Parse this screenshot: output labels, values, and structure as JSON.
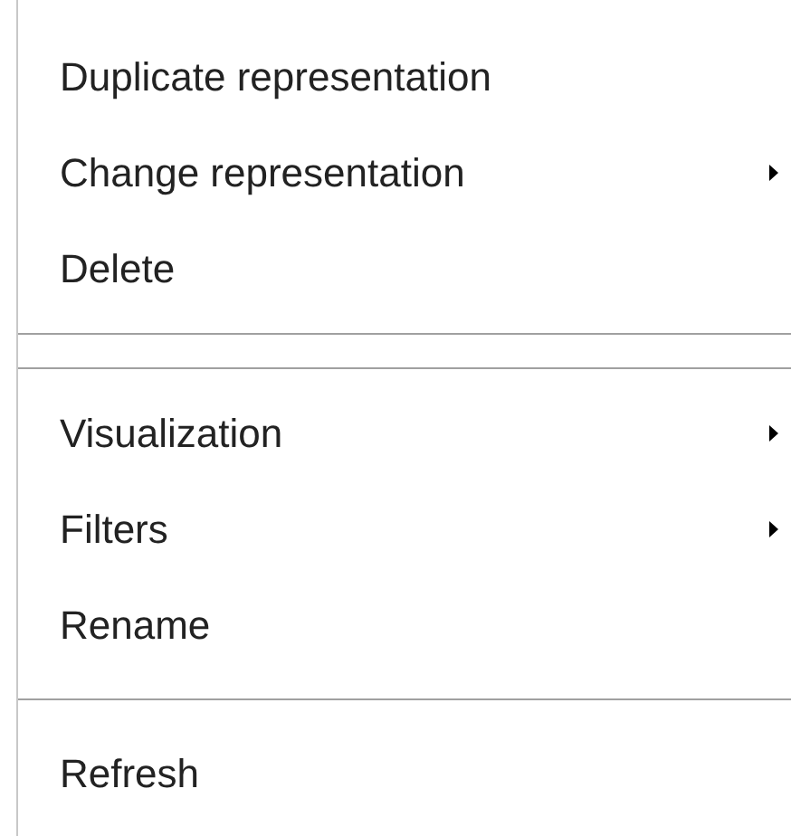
{
  "menu": {
    "items": [
      {
        "kind": "item",
        "label": "Duplicate representation",
        "has_submenu": false
      },
      {
        "kind": "item",
        "label": "Change representation",
        "has_submenu": true
      },
      {
        "kind": "item",
        "label": "Delete",
        "has_submenu": false
      },
      {
        "kind": "separator"
      },
      {
        "kind": "separator"
      },
      {
        "kind": "item",
        "label": "Visualization",
        "has_submenu": true
      },
      {
        "kind": "item",
        "label": "Filters",
        "has_submenu": true
      },
      {
        "kind": "item",
        "label": "Rename",
        "has_submenu": false
      },
      {
        "kind": "separator"
      },
      {
        "kind": "item",
        "label": "Refresh",
        "has_submenu": false
      }
    ]
  }
}
